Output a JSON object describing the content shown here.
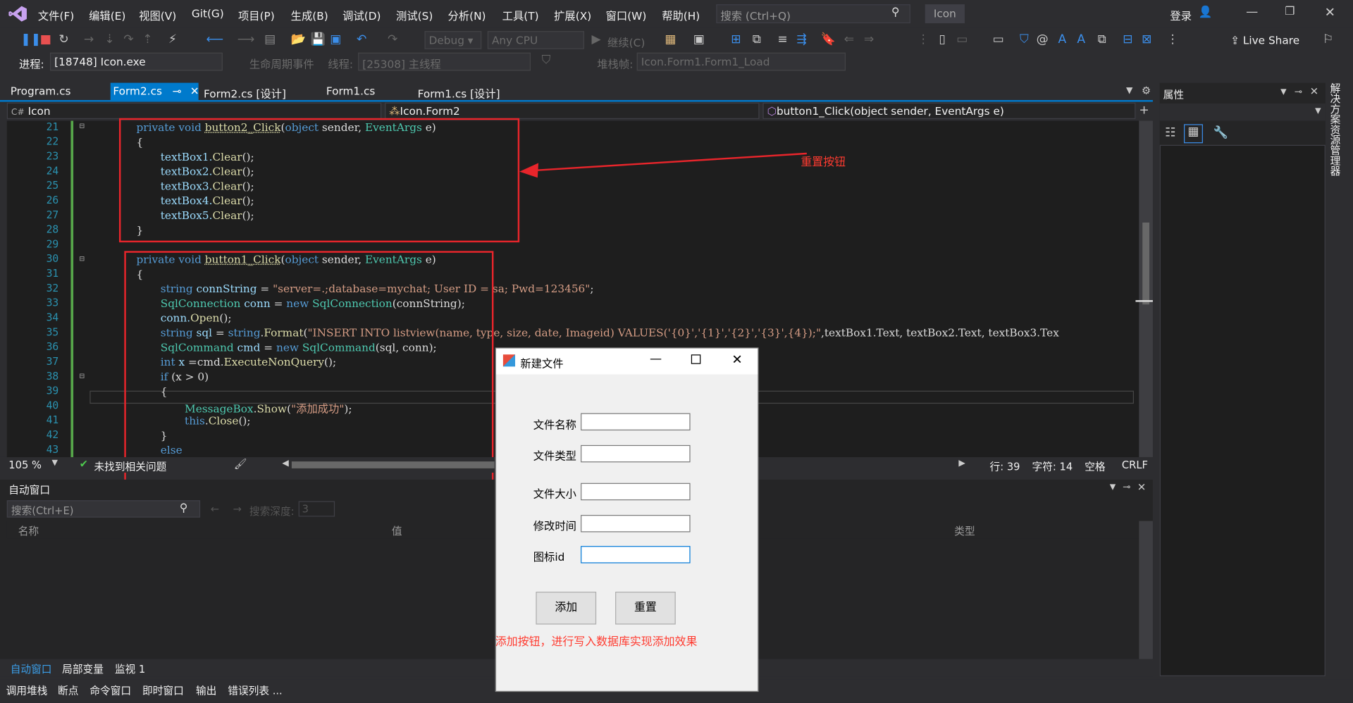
{
  "menu": [
    "文件(F)",
    "编辑(E)",
    "视图(V)",
    "Git(G)",
    "项目(P)",
    "生成(B)",
    "调试(D)",
    "测试(S)",
    "分析(N)",
    "工具(T)",
    "扩展(X)",
    "窗口(W)",
    "帮助(H)"
  ],
  "search_placeholder": "搜索 (Ctrl+Q)",
  "app_title": "Icon",
  "login": "登录",
  "live_share": "Live Share",
  "toolbar": {
    "config": "Debug",
    "platform": "Any CPU",
    "continue": "继续(C)",
    "process_label": "进程:",
    "process": "[18748] Icon.exe",
    "lifecycle": "生命周期事件",
    "thread_label": "线程:",
    "thread": "[25308] 主线程",
    "stack_label": "堆栈帧:",
    "stack": "Icon.Form1.Form1_Load"
  },
  "tabs": [
    "Program.cs",
    "Form2.cs",
    "Form2.cs [设计]",
    "Form1.cs",
    "Form1.cs [设计]"
  ],
  "nav": {
    "project": "Icon",
    "class": "Icon.Form2",
    "member": "button1_Click(object sender, EventArgs e)"
  },
  "line_numbers": [
    "21",
    "22",
    "23",
    "24",
    "25",
    "26",
    "27",
    "28",
    "29",
    "30",
    "31",
    "32",
    "33",
    "34",
    "35",
    "36",
    "37",
    "38",
    "39",
    "40",
    "41",
    "42",
    "43"
  ],
  "code": {
    "l21_mod": "private void ",
    "l21_name": "button2_Click",
    "l21_open": "(",
    "l21_obj": "object",
    "l21_mid": " sender, ",
    "l21_ea": "EventArgs",
    "l21_end": " e)",
    "l22": "{",
    "l23_a": "textBox1.",
    "l23_b": "Clear",
    "l23_c": "();",
    "l24_a": "textBox2.",
    "l24_b": "Clear",
    "l24_c": "();",
    "l25_a": "textBox3.",
    "l25_b": "Clear",
    "l25_c": "();",
    "l26_a": "textBox4.",
    "l26_b": "Clear",
    "l26_c": "();",
    "l27_a": "textBox5.",
    "l27_b": "Clear",
    "l27_c": "();",
    "l28": "}",
    "l30_mod": "private void ",
    "l30_name": "button1_Click",
    "l30_open": "(",
    "l30_obj": "object",
    "l30_mid": " sender, ",
    "l30_ea": "EventArgs",
    "l30_end": " e)",
    "l31": "{",
    "l32_kw": "string ",
    "l32_id": "connString",
    "l32_eq": " = ",
    "l32_str": "\"server=.;database=mychat; User ID = sa; Pwd=123456\"",
    "l32_end": ";",
    "l33_ty": "SqlConnection ",
    "l33_id": "conn",
    "l33_eq": " = ",
    "l33_new": "new ",
    "l33_ty2": "SqlConnection",
    "l33_end": "(connString);",
    "l34_a": "conn.",
    "l34_b": "Open",
    "l34_c": "();",
    "l35_kw": "string ",
    "l35_id": "sql",
    "l35_eq": " = ",
    "l35_kw2": "string",
    "l35_dot": ".",
    "l35_me": "Format",
    "l35_open": "(",
    "l35_str": "\"INSERT INTO listview(name, type, size, date, Imageid) VALUES('{0}','{1}','{2}','{3}',{4});\"",
    "l35_end": ",textBox1.Text, textBox2.Text, textBox3.Tex",
    "l36_ty": "SqlCommand ",
    "l36_id": "cmd",
    "l36_eq": " = ",
    "l36_new": "new ",
    "l36_ty2": "SqlCommand",
    "l36_end": "(sql, conn);",
    "l37_kw": "int ",
    "l37_id": "x",
    "l37_eq": " =cmd.",
    "l37_me": "ExecuteNonQuery",
    "l37_end": "();",
    "l38_kw": "if ",
    "l38_rest": "(x > 0)",
    "l39": "{",
    "l40_ty": "MessageBox",
    "l40_dot": ".",
    "l40_me": "Show",
    "l40_open": "(",
    "l40_str": "\"添加成功\"",
    "l40_end": ");",
    "l41_kw": "this",
    "l41_dot": ".",
    "l41_me": "Close",
    "l41_end": "();",
    "l42": "}",
    "l43": "else"
  },
  "annotations": {
    "reset": "重置按钮",
    "add": "添加按钮，进行写入数据库实现添加效果"
  },
  "editor_status": {
    "zoom": "105 %",
    "issues": "未找到相关问题",
    "line": "行: 39",
    "char": "字符: 14",
    "space": "空格",
    "eol": "CRLF"
  },
  "auto_window": {
    "title": "自动窗口",
    "search": "搜索(Ctrl+E)",
    "depth_label": "搜索深度:",
    "depth": "3",
    "columns": [
      "名称",
      "值",
      "类型"
    ]
  },
  "bottom_tabs1": [
    "自动窗口",
    "局部变量",
    "监视 1"
  ],
  "bottom_tabs2": [
    "调用堆栈",
    "断点",
    "命令窗口",
    "即时窗口",
    "输出",
    "错误列表 ..."
  ],
  "props_title": "属性",
  "solution_explorer": "解决方案资源管理器",
  "dialog": {
    "title": "新建文件",
    "labels": [
      "文件名称",
      "文件类型",
      "文件大小",
      "修改时间",
      "图标id"
    ],
    "add": "添加",
    "reset": "重置"
  }
}
